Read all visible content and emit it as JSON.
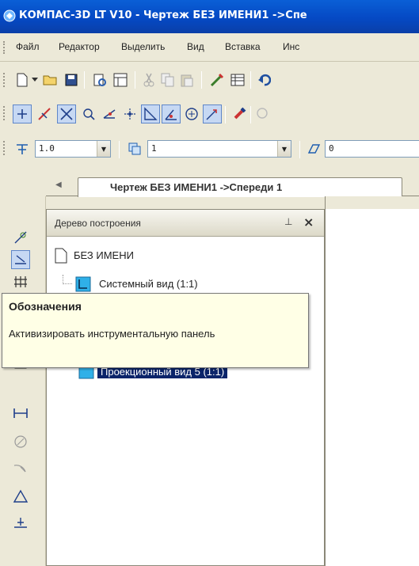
{
  "window": {
    "title": "КОМПАС-3D LT V10 - Чертеж БЕЗ ИМЕНИ1 ->Спе",
    "app_icon": "kompas-app-icon"
  },
  "menu": {
    "items": [
      "Файл",
      "Редактор",
      "Выделить",
      "Вид",
      "Вставка",
      "Инс"
    ]
  },
  "toolbar_standard": {
    "icons": [
      "new-document-icon",
      "dropdown-icon",
      "open-folder-icon",
      "save-icon",
      "print-preview-icon",
      "layout-icon",
      "cut-icon",
      "copy-icon",
      "paste-icon",
      "properties-icon",
      "table-icon",
      "undo-icon"
    ]
  },
  "toolbar_view": {
    "icons": [
      "snap-grid-icon",
      "line-tool-icon",
      "cross-select-icon",
      "point-select-icon",
      "angle-icon",
      "ortho-icon",
      "corner-icon",
      "corner-2-icon",
      "circle-snap-icon",
      "arrow-snap-icon",
      "magnet-icon",
      "zoom-icon"
    ]
  },
  "toolbar_params": {
    "scale_value": "1.0",
    "layer_value": "1",
    "style_value": "0"
  },
  "document_tab": {
    "label": "Чертеж БЕЗ ИМЕНИ1 ->Спереди 1"
  },
  "tree_panel": {
    "title": "Дерево построения",
    "pin_icon": "pin-icon",
    "close_label": "×",
    "items": [
      {
        "label": "БЕЗ ИМЕНИ",
        "icon": "document-icon"
      },
      {
        "label": "Системный вид (1:1)",
        "icon": "view-icon"
      },
      {
        "label": "Проекционный вид 5 (1:1)",
        "icon": "view-icon"
      }
    ]
  },
  "tooltip": {
    "title": "Обозначения",
    "body": "Активизировать инструментальную панель"
  },
  "left_toolbar": {
    "icons": [
      "geometry-icon",
      "dimensions-icon",
      "designations-icon",
      "edit-icon",
      "parametrization-icon",
      "measure-icon",
      "select-icon",
      "linear-dim-icon",
      "angular-dim-icon",
      "radial-dim-icon",
      "triangle-icon",
      "base-icon"
    ]
  },
  "colors": {
    "titlebar": "#0549c4",
    "selection": "#0a246a",
    "tooltip_bg": "#ffffe6"
  }
}
